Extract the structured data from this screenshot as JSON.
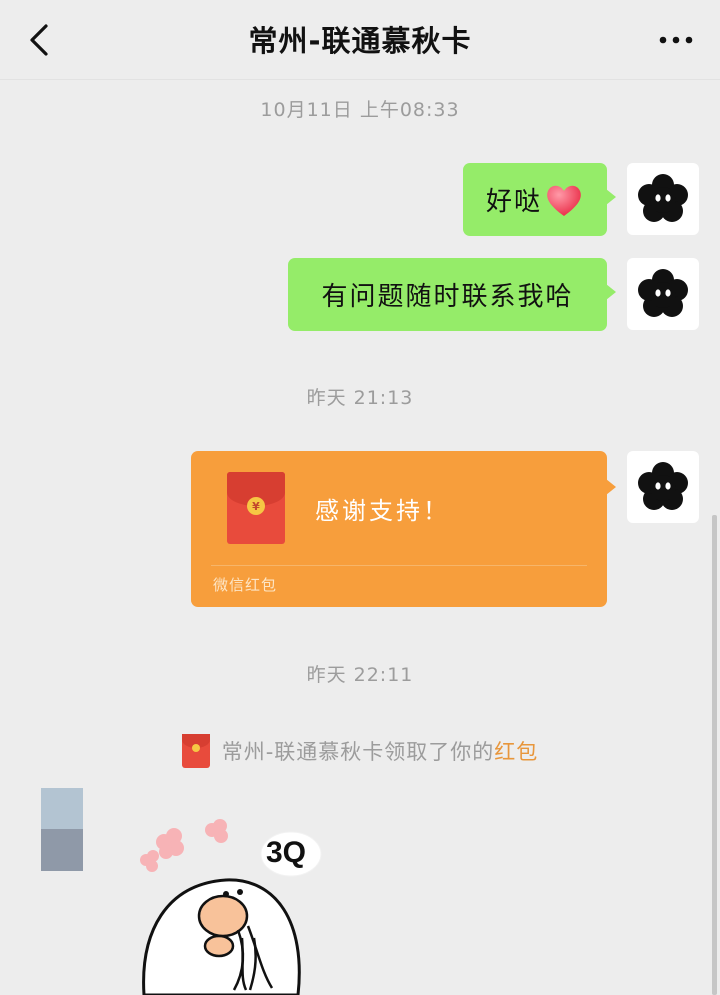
{
  "header": {
    "title": "常州-联通慕秋卡"
  },
  "messages": {
    "timestamp_1": "10月11日 上午08:33",
    "msg_1": "好哒",
    "msg_2": "有问题随时联系我哈",
    "timestamp_2": "昨天 21:13",
    "red_packet": {
      "greeting": "感谢支持！",
      "label": "微信红包",
      "coin_symbol": "¥"
    },
    "timestamp_3": "昨天 22:11",
    "notice": {
      "text": "常州-联通慕秋卡领取了你的",
      "link": "红包"
    },
    "sticker_text": "3Q"
  },
  "colors": {
    "bubble_green": "#95ec69",
    "red_packet_orange": "#f79e3c",
    "notice_link": "#e8963b"
  },
  "icons": {
    "back": "chevron-left-icon",
    "more": "more-dots-icon",
    "heart": "heart-emoji-icon"
  }
}
